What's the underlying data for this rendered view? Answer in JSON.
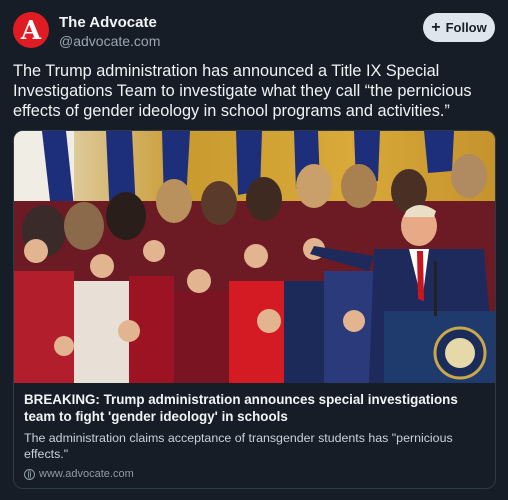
{
  "author": {
    "avatar_letter": "A",
    "name": "The Advocate",
    "handle": "@advocate.com",
    "brand_color": "#e01b22"
  },
  "follow_button": {
    "label": "Follow",
    "icon": "plus-icon"
  },
  "post": {
    "text": "The Trump administration has announced a Title IX Special Investigations Team to investigate what they call “the pernicious effects of gender ideology in school programs and activities.”"
  },
  "link_card": {
    "title": "BREAKING: Trump administration announces special investigations team to fight 'gender ideology' in schools",
    "description": "The administration claims acceptance of transgender students has \"pernicious effects.\"",
    "domain": "www.advocate.com",
    "domain_icon": "globe-icon"
  },
  "colors": {
    "background": "#161d26",
    "card_border": "#2f3a47",
    "follow_bg": "#dfe5ec"
  }
}
